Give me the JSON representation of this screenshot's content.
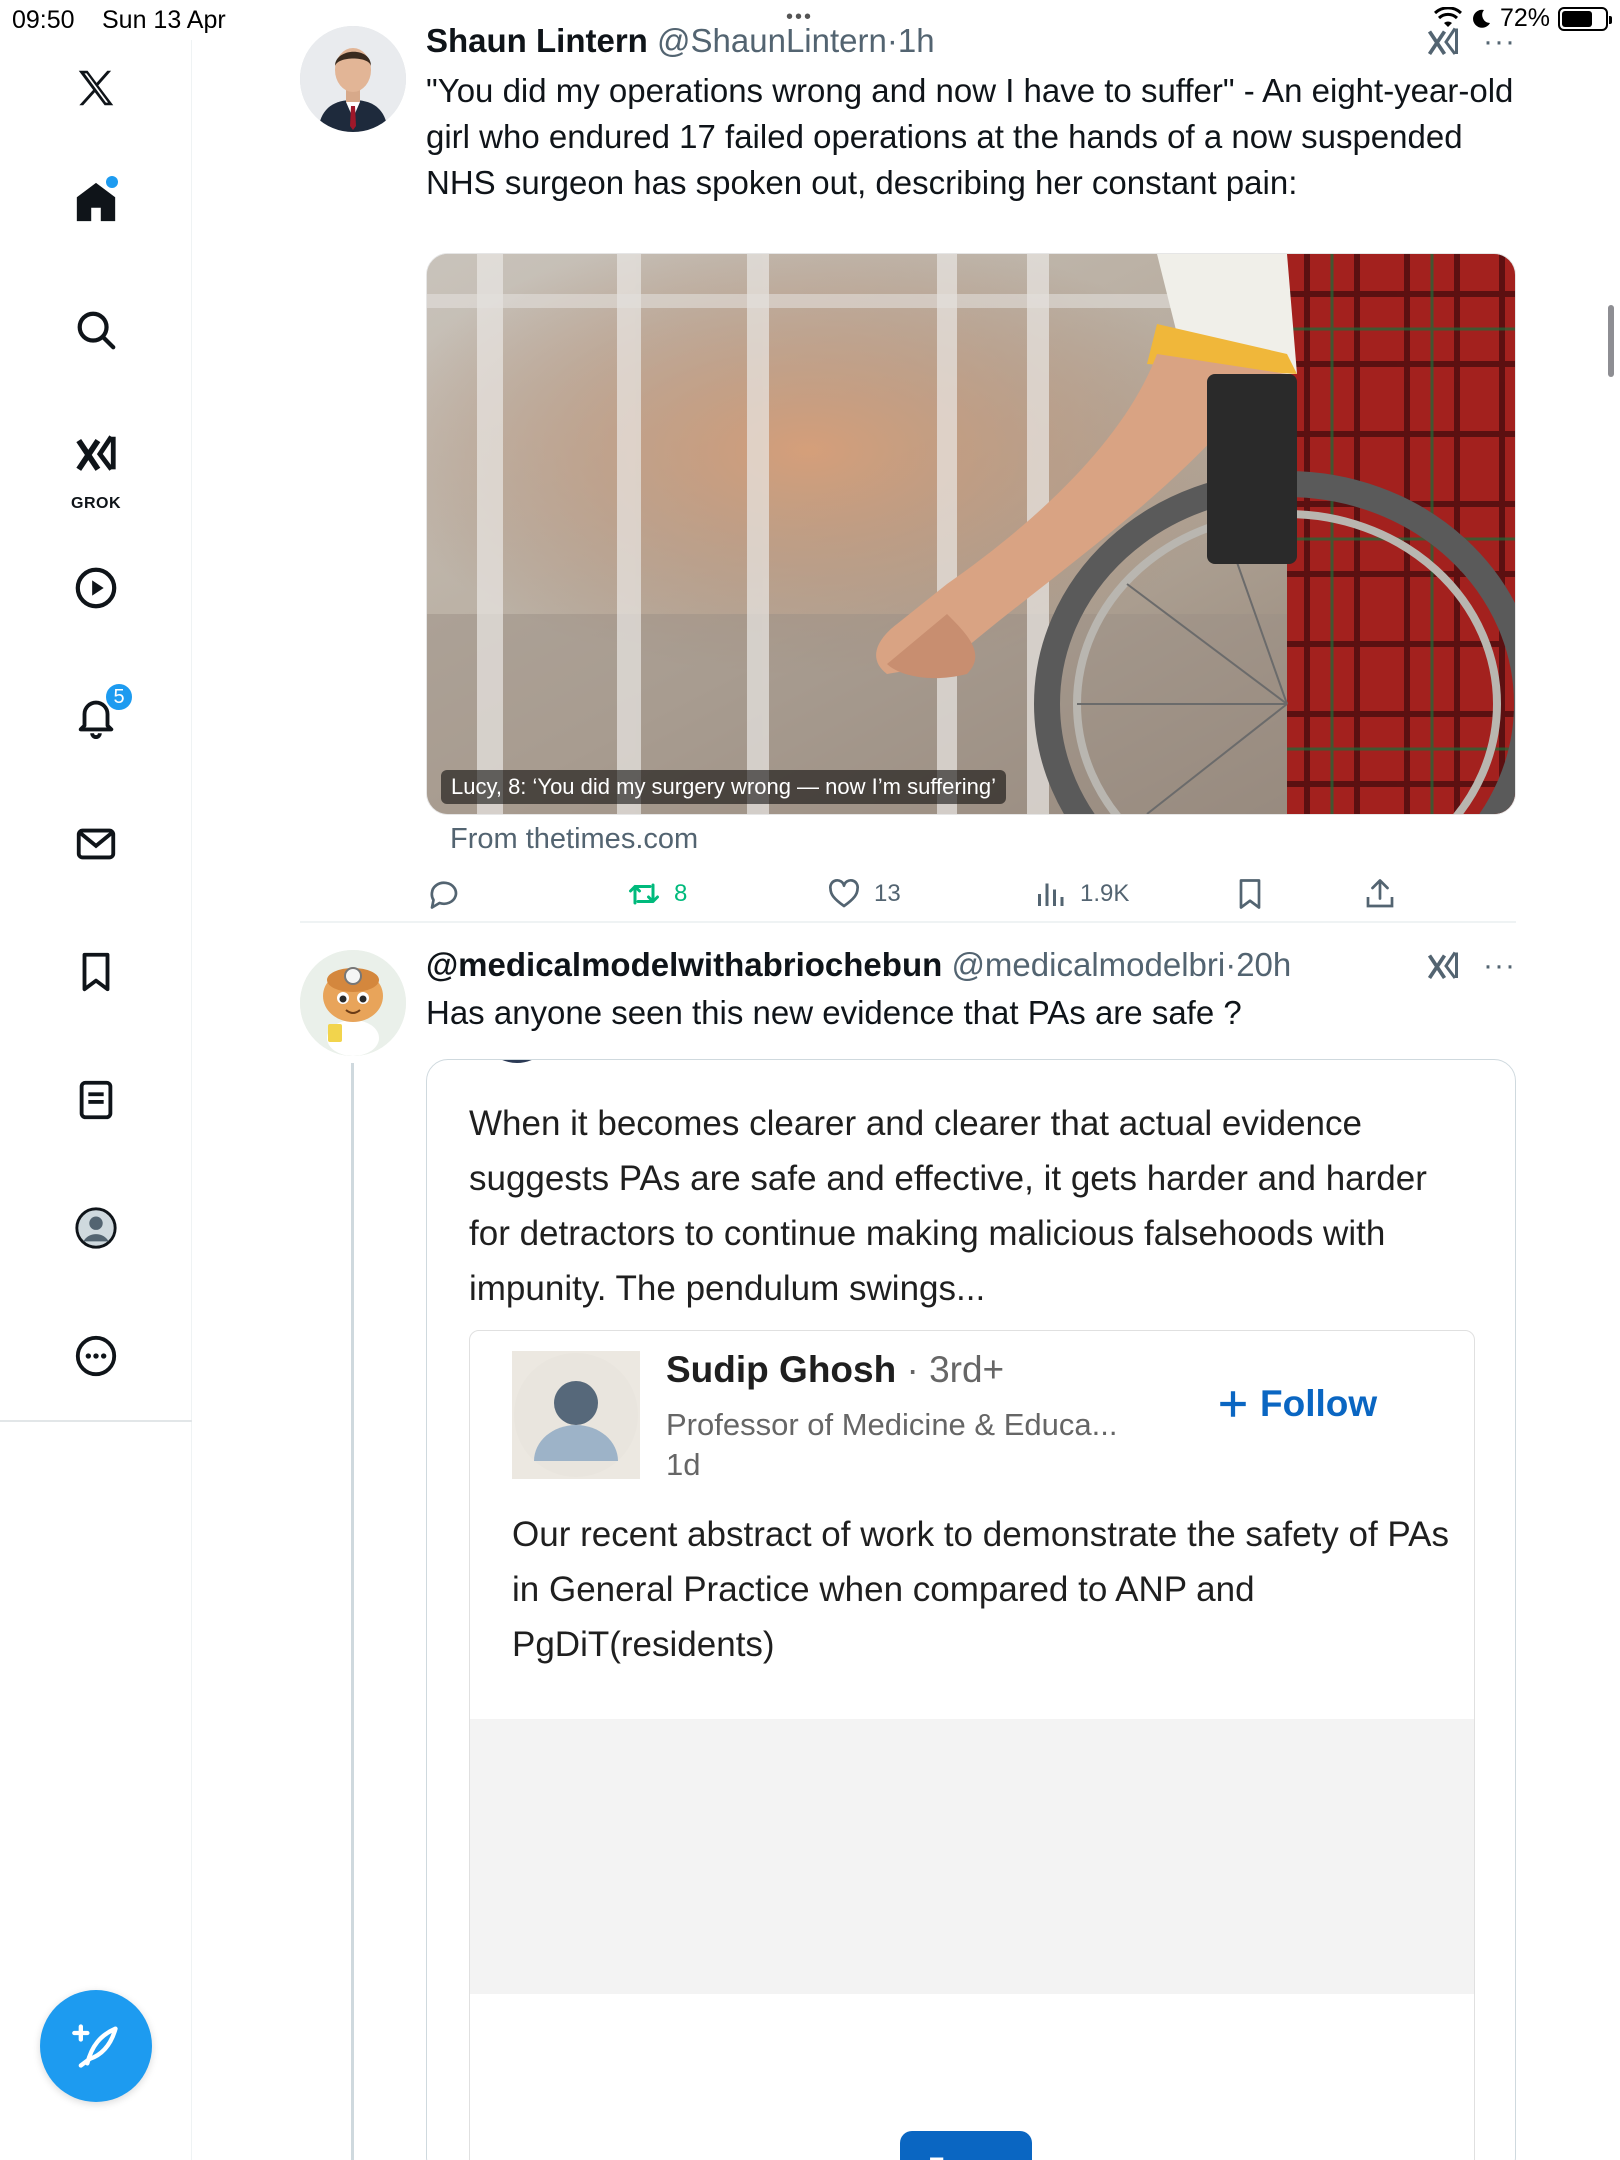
{
  "status_bar": {
    "time": "09:50",
    "date": "Sun 13 Apr",
    "battery": "72%",
    "battery_level": 0.72
  },
  "sidebar": {
    "grok_label": "GROK",
    "notifications_count": "5"
  },
  "tweet1": {
    "name": "Shaun Lintern",
    "handle": "@ShaunLintern",
    "time": "1h",
    "text": "\"You did my operations wrong and now I have to suffer\" - An eight-year-old girl who endured 17 failed operations at the hands of a now suspended NHS surgeon has spoken out, describing her constant pain:",
    "media_caption": "Lucy, 8: ‘You did my surgery wrong — now I’m suffering’",
    "source": "From thetimes.com",
    "retweets": "8",
    "likes": "13",
    "views": "1.9K"
  },
  "tweet2": {
    "name": "@medicalmodelwithabriochebun",
    "handle": "@medicalmodelbri",
    "time": "20h",
    "text": "Has anyone seen this new evidence that PAs are safe ?",
    "embed": {
      "post_text": "When it becomes clearer and clearer that actual evidence suggests PAs are safe and effective, it gets harder and harder for detractors to continue making malicious falsehoods with impunity. The pendulum swings...",
      "author_name": "Sudip Ghosh",
      "author_degree": "· 3rd+",
      "author_role": "Professor of Medicine & Educa...",
      "author_when": "1d",
      "follow_label": "Follow",
      "body": "Our recent abstract of work to demonstrate the safety of PAs in General Practice when compared to ANP and PgDiT(residents)",
      "logo_text": "in"
    }
  },
  "colors": {
    "accent": "#1d9bf0",
    "retweet_green": "#00ba7c",
    "linkedin_blue": "#0a66c2",
    "secondary_text": "#536471"
  },
  "icons": [
    "x-logo-icon",
    "home-icon",
    "search-icon",
    "grok-icon",
    "video-icon",
    "bell-icon",
    "mail-icon",
    "bookmark-icon",
    "lists-icon",
    "profile-icon",
    "more-icon",
    "compose-icon",
    "reply-icon",
    "retweet-icon",
    "like-icon",
    "views-icon",
    "share-icon",
    "wifi-icon",
    "moon-icon",
    "battery-icon"
  ]
}
